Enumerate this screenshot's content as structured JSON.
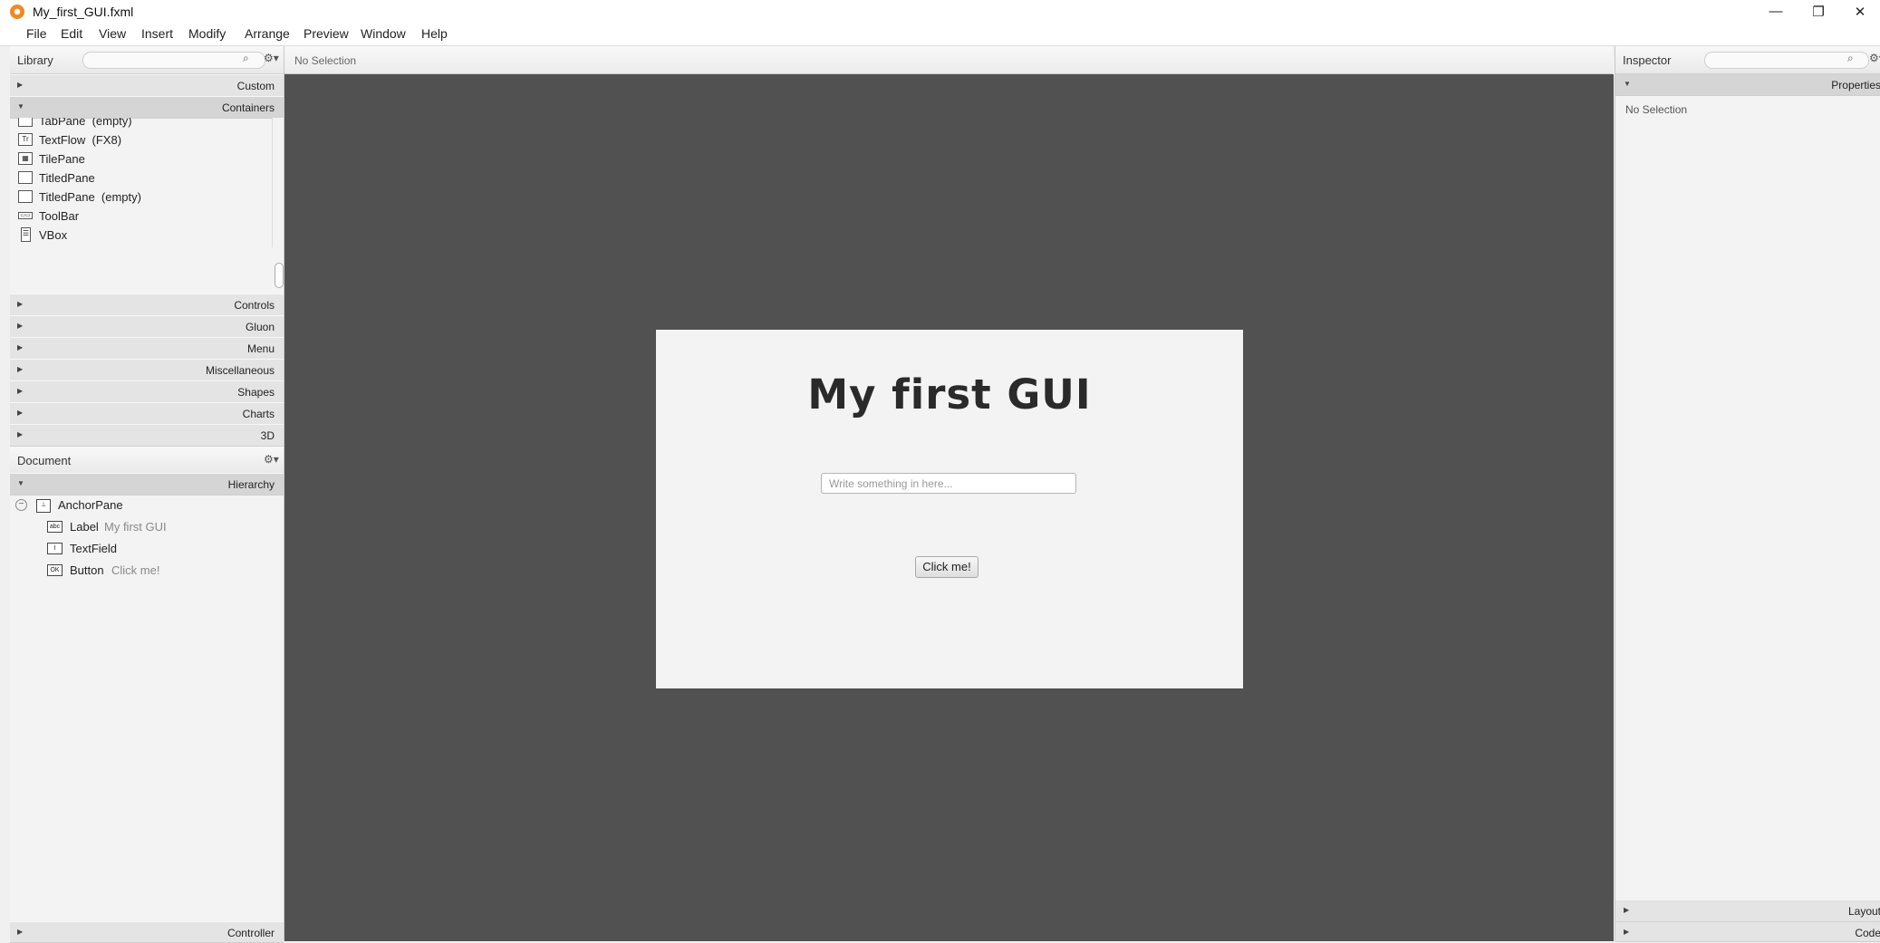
{
  "window": {
    "title": "My_first_GUI.fxml",
    "minimize": "—",
    "restore": "❐",
    "close": "✕"
  },
  "menu": [
    "File",
    "Edit",
    "View",
    "Insert",
    "Modify",
    "Arrange",
    "Preview",
    "Window",
    "Help"
  ],
  "library": {
    "title": "Library",
    "sections_before": [
      "Custom"
    ],
    "open_section": "Containers",
    "items": [
      {
        "label": "TabPane",
        "suffix": "(empty)",
        "icon": "tabpane-icon",
        "glyph": ""
      },
      {
        "label": "TextFlow",
        "suffix": "(FX8)",
        "icon": "textflow-icon",
        "glyph": "Tr"
      },
      {
        "label": "TilePane",
        "suffix": "",
        "icon": "tilepane-icon",
        "glyph": "▦"
      },
      {
        "label": "TitledPane",
        "suffix": "",
        "icon": "titledpane-icon",
        "glyph": ""
      },
      {
        "label": "TitledPane",
        "suffix": "(empty)",
        "icon": "titledpane-icon",
        "glyph": ""
      },
      {
        "label": "ToolBar",
        "suffix": "",
        "icon": "toolbar-icon",
        "glyph": "▭▭"
      },
      {
        "label": "VBox",
        "suffix": "",
        "icon": "vbox-icon",
        "glyph": "☰"
      }
    ],
    "sections_after": [
      "Controls",
      "Gluon",
      "Menu",
      "Miscellaneous",
      "Shapes",
      "Charts",
      "3D"
    ]
  },
  "document": {
    "title": "Document",
    "hierarchy_label": "Hierarchy",
    "root": {
      "type": "AnchorPane",
      "toggle": "−"
    },
    "children": [
      {
        "type": "Label",
        "value": "My first GUI",
        "icon": "label-icon",
        "glyph": "abc"
      },
      {
        "type": "TextField",
        "value": "",
        "icon": "textfield-icon",
        "glyph": "I"
      },
      {
        "type": "Button",
        "value": "Click me!",
        "icon": "button-icon",
        "glyph": "OK"
      }
    ],
    "controller_label": "Controller"
  },
  "center": {
    "selection_status": "No Selection"
  },
  "design": {
    "label_text": "My first GUI",
    "textfield_placeholder": "Write something in here...",
    "button_text": "Click me!"
  },
  "inspector": {
    "title": "Inspector",
    "properties_label": "Properties",
    "no_selection": "No Selection",
    "layout_label": "Layout",
    "code_label": "Code"
  },
  "colors": {
    "canvas": "#515151",
    "design_bg": "#f3f3f3",
    "app_icon": "#f08a1c"
  }
}
